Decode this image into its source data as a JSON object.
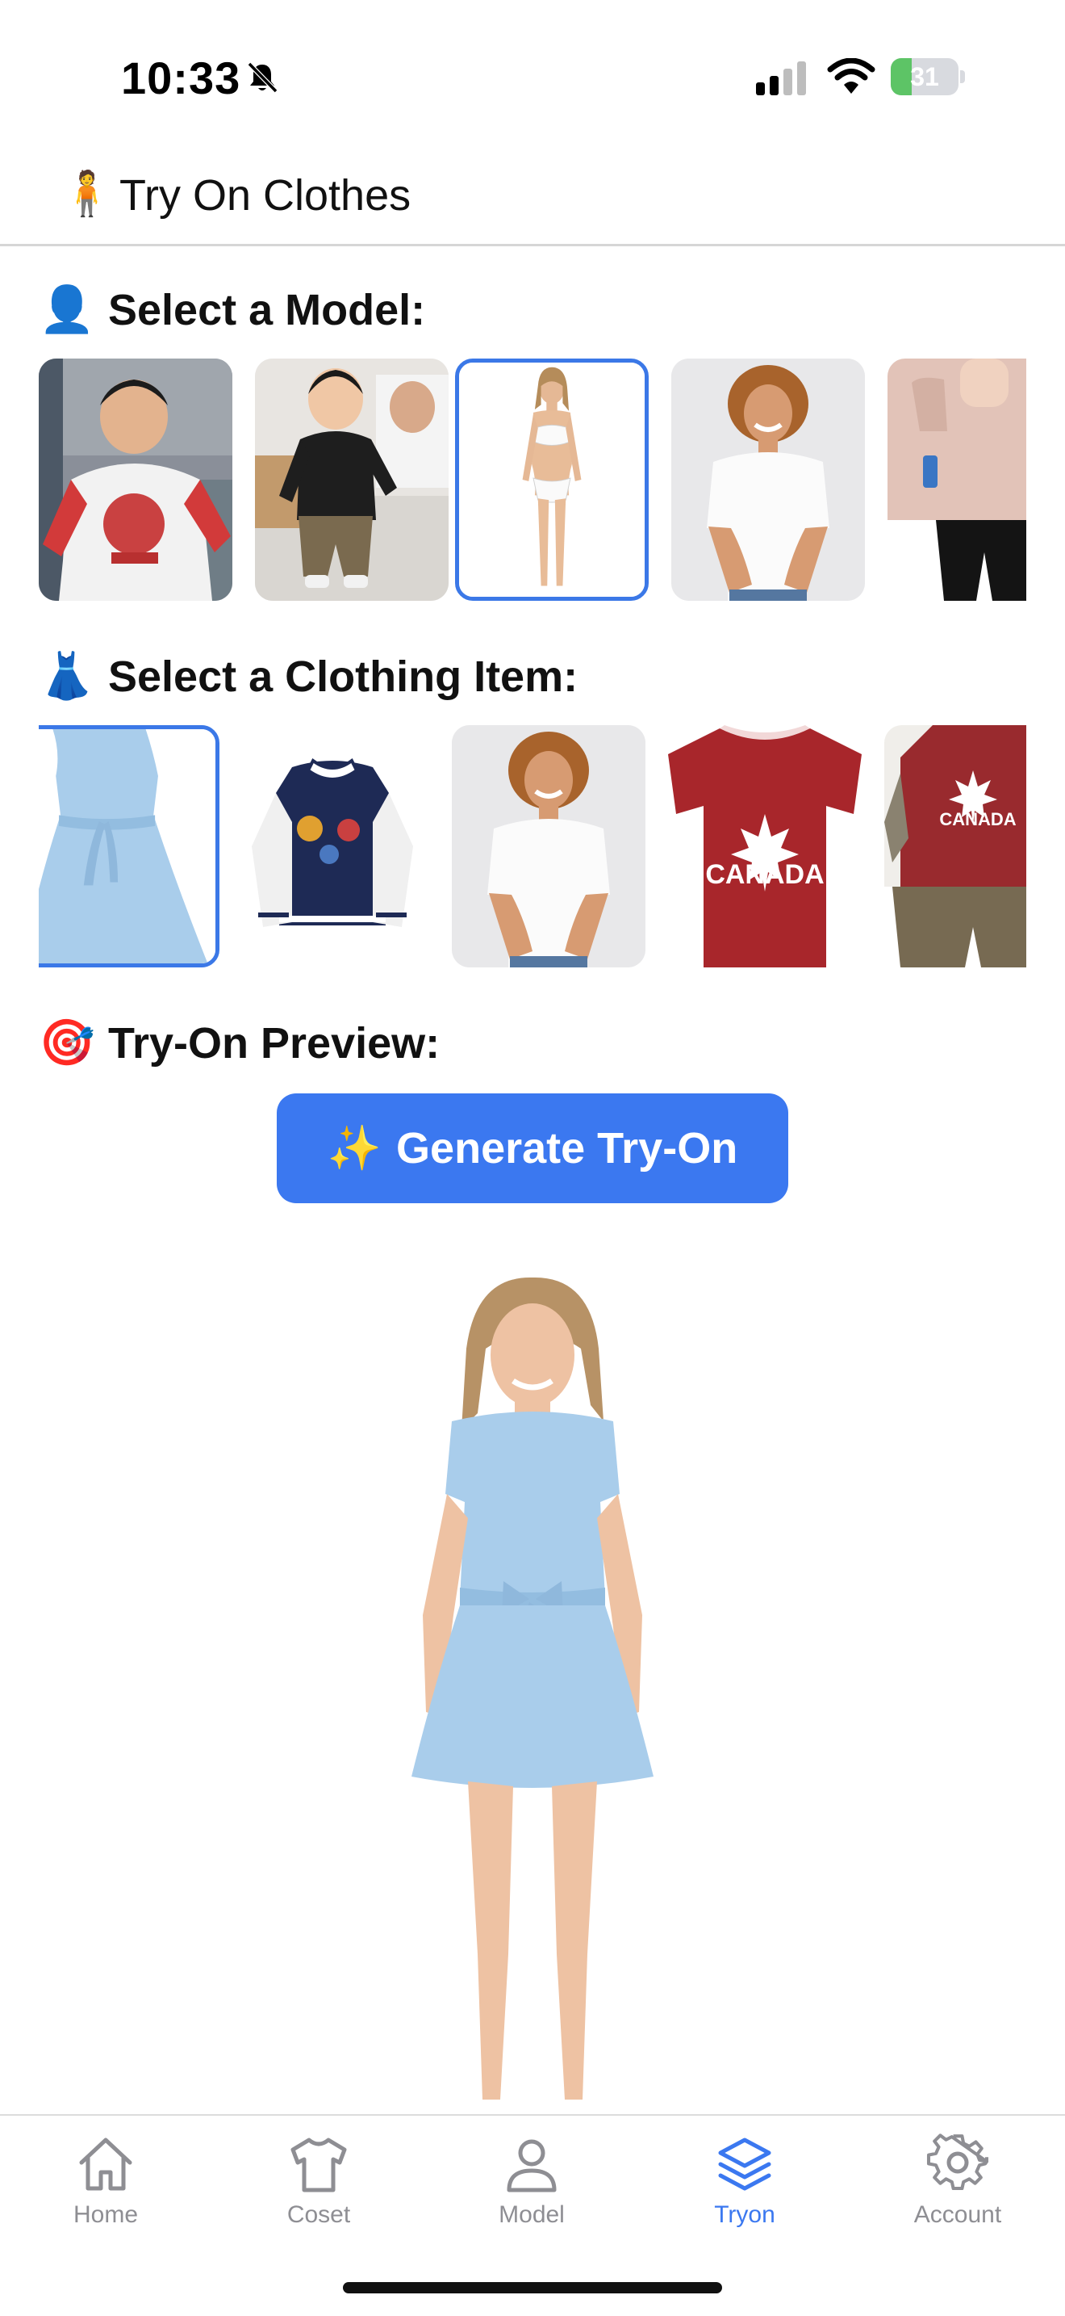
{
  "status_bar": {
    "time": "10:33",
    "battery_percent": 31,
    "battery_label": "31",
    "icons": [
      "bell-slash-icon",
      "cellular-signal-icon",
      "wifi-icon",
      "battery-charging-icon"
    ]
  },
  "header": {
    "emoji": "🧍",
    "title": "Try On Clothes"
  },
  "models_section": {
    "emoji": "👤",
    "title": "Select a Model:",
    "selected_index": 2
  },
  "clothing_section": {
    "emoji": "👗",
    "title": "Select a Clothing Item:",
    "selected_index": 0
  },
  "preview_section": {
    "emoji": "🎯",
    "title": "Try-On Preview:"
  },
  "generate_button": {
    "icon": "✨",
    "label": "Generate Try-On"
  },
  "clothing_items": {
    "canada_tshirt_text": "CANADA",
    "canada_child_text": "CANADA"
  },
  "tab_bar": {
    "tabs": [
      {
        "label": "Home",
        "icon": "house-icon",
        "active": false
      },
      {
        "label": "Coset",
        "icon": "tshirt-icon",
        "active": false
      },
      {
        "label": "Model",
        "icon": "person-icon",
        "active": false
      },
      {
        "label": "Tryon",
        "icon": "layers-icon",
        "active": true
      },
      {
        "label": "Account",
        "icon": "gear-icon",
        "active": false
      }
    ]
  },
  "colors": {
    "accent": "#3b78f0",
    "selected_border": "#3b78e7",
    "inactive_tab": "#8e8e93",
    "battery_green": "#5dc466"
  }
}
